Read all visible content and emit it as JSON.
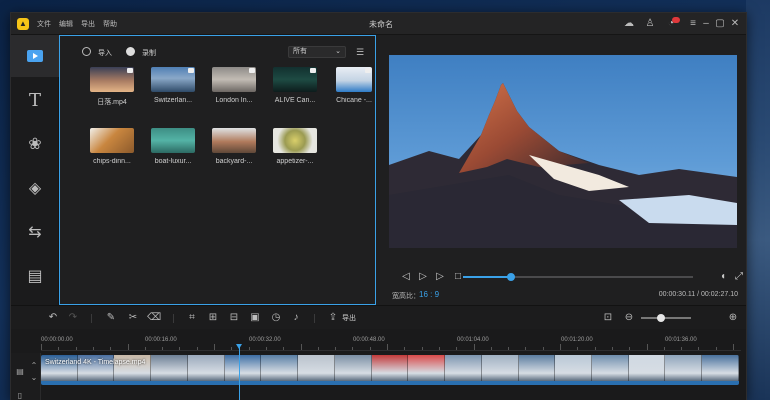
{
  "app": {
    "title": "未命名",
    "menu": [
      "文件",
      "编辑",
      "导出",
      "帮助"
    ]
  },
  "colors": {
    "accent": "#3aa1e8",
    "logo": "#f6c417",
    "badge": "#e0383b"
  },
  "titlebar_icons": [
    "cloud-sync-icon",
    "user-icon",
    "notification-icon",
    "menu-icon",
    "minimize-icon",
    "maximize-icon",
    "close-icon"
  ],
  "rail": [
    "media-icon",
    "text-icon",
    "filters-icon",
    "overlays-icon",
    "transitions-icon",
    "elements-icon"
  ],
  "library": {
    "import_label": "导入",
    "record_label": "录制",
    "filter_value": "所有",
    "items": [
      {
        "label": "日落.mp4",
        "thumb": "sunset"
      },
      {
        "label": "Switzerlan...",
        "thumb": "mountain"
      },
      {
        "label": "London In...",
        "thumb": "city"
      },
      {
        "label": "ALIVE Can...",
        "thumb": "dark"
      },
      {
        "label": "Chicane -...",
        "thumb": "blue"
      },
      {
        "label": "chips-dinn...",
        "thumb": "food"
      },
      {
        "label": "boat-luxur...",
        "thumb": "boat"
      },
      {
        "label": "backyard-...",
        "thumb": "yard"
      },
      {
        "label": "appetizer-...",
        "thumb": "plate"
      }
    ]
  },
  "preview": {
    "aspect_label": "宽高比：",
    "aspect_value": "16 : 9",
    "timecode": "00:00:30.11 / 00:02:27.10",
    "progress": 0.21
  },
  "toolbar": {
    "export_label": "导出",
    "zoom_level": 0.4
  },
  "timeline": {
    "ticks": [
      "00:00:00.00",
      "00:00:16.00",
      "00:00:32.00",
      "00:00:48.00",
      "00:01:04.00",
      "00:01:20.00",
      "00:01:36.00"
    ],
    "clip_label": "Switzerland 4K - Timelapse.mp4",
    "frames": [
      "#2a5f98",
      "#4a6fa0",
      "#c8b9a8",
      "#6d7f95",
      "#9aa9bc",
      "#3d6ea5",
      "#5a7fa6",
      "#b9c2cc",
      "#7b8fa5",
      "#c23a3a",
      "#d84a4a",
      "#7c95b0",
      "#9fb0c2",
      "#5c7da0",
      "#b8c7d6",
      "#6f8eae",
      "#cfd8e2",
      "#8ea4bb",
      "#48709c"
    ]
  }
}
